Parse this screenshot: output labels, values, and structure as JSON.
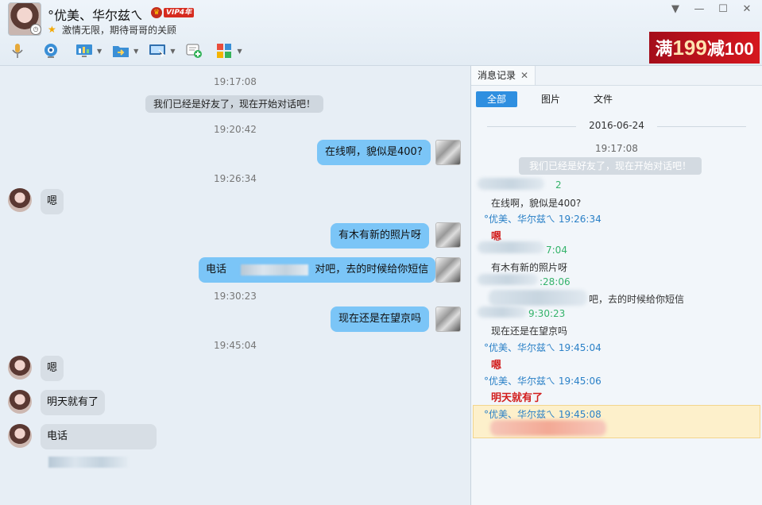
{
  "header": {
    "nickname": "°优美、华尔兹ㄟ",
    "vip_label": "VIP4年",
    "signature": "激情无限，期待哥哥的关顾",
    "ad_text": {
      "p1": "满",
      "p2": "199",
      "p3": "减100"
    }
  },
  "chat": {
    "system_message": "我们已经是好友了，现在开始对话吧！",
    "times": [
      "19:17:08",
      "19:20:42",
      "19:26:34",
      "19:30:23",
      "19:45:04"
    ],
    "messages": {
      "m1": "在线啊，貌似是400?",
      "m2": "嗯",
      "m3": "有木有新的照片呀",
      "m4_prefix": "电话",
      "m4_suffix": "对吧，去的时候给你短信",
      "m5": "现在还是在望京吗",
      "m6": "嗯",
      "m7": "明天就有了",
      "m8_prefix": "电话"
    }
  },
  "history": {
    "tab_title": "消息记录",
    "filters": [
      "全部",
      "图片",
      "文件"
    ],
    "date": "2016-06-24",
    "first_time": "19:17:08",
    "system_message": "我们已经是好友了，现在开始对话吧！",
    "entries": {
      "e1_time_frag": "2",
      "e1_text": "在线啊，貌似是400?",
      "e2_head": "°优美、华尔兹ㄟ 19:26:34",
      "e2_text": "嗯",
      "e3_time_frag": "7:04",
      "e3_text": "有木有新的照片呀",
      "e4_time_frag": ":28:06",
      "e4_text": "吧，去的时候给你短信",
      "e5_time_frag": "9:30:23",
      "e5_text": "现在还是在望京吗",
      "e6_head": "°优美、华尔兹ㄟ 19:45:04",
      "e6_text": "嗯",
      "e7_head": "°优美、华尔兹ㄟ 19:45:06",
      "e7_text": "明天就有了",
      "e8_head": "°优美、华尔兹ㄟ 19:45:08"
    }
  }
}
